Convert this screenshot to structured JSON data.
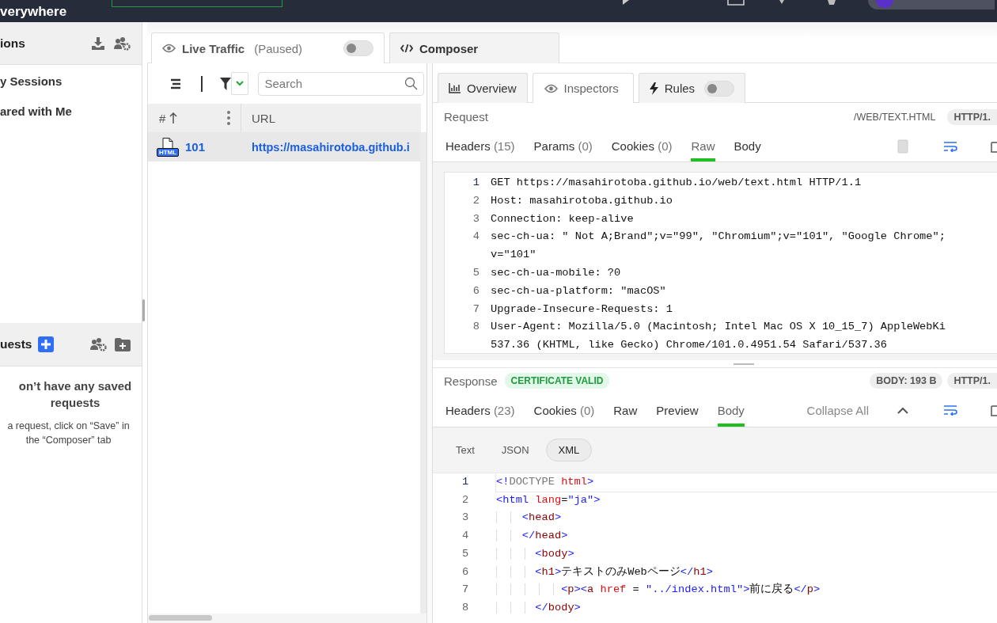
{
  "top_bar": {
    "title": "verywhere"
  },
  "sidebar": {
    "sessions": {
      "title": "ions",
      "items": [
        "y Sessions",
        "ared with Me"
      ]
    },
    "saved_requests": {
      "title": "uests",
      "empty_title": "on’t have any saved requests",
      "empty_hint": "a request, click on “Save” in the “Composer” tab"
    }
  },
  "main_tabs": [
    {
      "kind": "live",
      "label": "Live Traffic",
      "note": "(Paused)",
      "toggle": false,
      "selected": true
    },
    {
      "kind": "composer",
      "label": "Composer",
      "selected": false
    }
  ],
  "traffic": {
    "search": {
      "placeholder": "Search"
    },
    "columns": [
      "#",
      "URL"
    ],
    "rows": [
      {
        "badge": "HTML",
        "number": "101",
        "url": "https://masahirotoba.github.i",
        "selected": true
      }
    ]
  },
  "inspector": {
    "tabs": [
      {
        "kind": "overview",
        "label": "Overview",
        "selected": false
      },
      {
        "kind": "inspectors",
        "label": "Inspectors",
        "selected": true
      },
      {
        "kind": "rules",
        "label": "Rules",
        "toggle": false,
        "selected": false
      }
    ],
    "request": {
      "title": "Request",
      "path": "/WEB/TEXT.HTML",
      "protocol": "HTTP/1.",
      "tabs": [
        {
          "label": "Headers",
          "count": "(15)",
          "selected": false
        },
        {
          "label": "Params",
          "count": "(0)",
          "selected": false
        },
        {
          "label": "Cookies",
          "count": "(0)",
          "selected": false
        },
        {
          "label": "Raw",
          "selected": true
        },
        {
          "label": "Body",
          "selected": false
        }
      ],
      "lines": [
        {
          "number": "1",
          "active": true,
          "text": [
            "GET https://masahirotoba.github.io/web/text.html HTTP/1.1"
          ]
        },
        {
          "number": "2",
          "active": false,
          "text": [
            "Host: masahirotoba.github.io"
          ]
        },
        {
          "number": "3",
          "active": false,
          "text": [
            "Connection: keep-alive"
          ]
        },
        {
          "number": "4",
          "active": false,
          "text": [
            "sec-ch-ua: \" Not A;Brand\";v=\"99\", \"Chromium\";v=\"101\", \"Google Chrome\";",
            "v=\"101\""
          ]
        },
        {
          "number": "5",
          "active": false,
          "text": [
            "sec-ch-ua-mobile: ?0"
          ]
        },
        {
          "number": "6",
          "active": false,
          "text": [
            "sec-ch-ua-platform: \"macOS\""
          ]
        },
        {
          "number": "7",
          "active": false,
          "text": [
            "Upgrade-Insecure-Requests: 1"
          ]
        },
        {
          "number": "8",
          "active": false,
          "text": [
            "User-Agent: Mozilla/5.0 (Macintosh; Intel Mac OS X 10_15_7) AppleWebKi",
            "537.36 (KHTML, like Gecko) Chrome/101.0.4951.54 Safari/537.36"
          ]
        }
      ]
    },
    "response": {
      "title": "Response",
      "badge": "CERTIFICATE VALID",
      "size": "BODY: 193 B",
      "protocol": "HTTP/1.",
      "tabs": [
        {
          "label": "Headers",
          "count": "(23)",
          "selected": false
        },
        {
          "label": "Cookies",
          "count": "(0)",
          "selected": false
        },
        {
          "label": "Raw",
          "selected": false
        },
        {
          "label": "Preview",
          "selected": false
        },
        {
          "label": "Body",
          "selected": true
        }
      ],
      "collapse": "Collapse All",
      "formats": [
        {
          "label": "Text",
          "selected": false
        },
        {
          "label": "JSON",
          "selected": false
        },
        {
          "label": "XML",
          "selected": true
        }
      ],
      "lines": [
        {
          "number": "1",
          "active": true,
          "tokens": [
            {
              "kind": "punct",
              "text": "<!"
            },
            {
              "kind": "doctype",
              "text": "DOCTYPE "
            },
            {
              "kind": "attr",
              "text": "html"
            },
            {
              "kind": "punct",
              "text": ">"
            }
          ]
        },
        {
          "number": "2",
          "active": false,
          "tokens": [
            {
              "kind": "punct",
              "text": "<html "
            },
            {
              "kind": "attr",
              "text": "lang"
            },
            {
              "kind": "text",
              "text": "="
            },
            {
              "kind": "str",
              "text": "\"ja\""
            },
            {
              "kind": "punct",
              "text": ">"
            }
          ]
        },
        {
          "number": "3",
          "active": false,
          "tokens": [
            {
              "kind": "punct",
              "text": "    <"
            },
            {
              "kind": "tag",
              "text": "head"
            },
            {
              "kind": "punct",
              "text": ">"
            }
          ]
        },
        {
          "number": "4",
          "active": false,
          "tokens": [
            {
              "kind": "punct",
              "text": "    </"
            },
            {
              "kind": "tag",
              "text": "head"
            },
            {
              "kind": "punct",
              "text": ">"
            }
          ]
        },
        {
          "number": "5",
          "active": false,
          "tokens": [
            {
              "kind": "punct",
              "text": "      <"
            },
            {
              "kind": "tag",
              "text": "body"
            },
            {
              "kind": "punct",
              "text": ">"
            }
          ]
        },
        {
          "number": "6",
          "active": false,
          "tokens": [
            {
              "kind": "punct",
              "text": "      <"
            },
            {
              "kind": "tag",
              "text": "h1"
            },
            {
              "kind": "punct",
              "text": ">"
            },
            {
              "kind": "text",
              "text": "テキストのみWebページ"
            },
            {
              "kind": "punct",
              "text": "</"
            },
            {
              "kind": "tag",
              "text": "h1"
            },
            {
              "kind": "punct",
              "text": ">"
            }
          ]
        },
        {
          "number": "7",
          "active": false,
          "tokens": [
            {
              "kind": "punct",
              "text": "          <"
            },
            {
              "kind": "tag",
              "text": "p"
            },
            {
              "kind": "punct",
              "text": "><"
            },
            {
              "kind": "tag",
              "text": "a "
            },
            {
              "kind": "attr",
              "text": "href"
            },
            {
              "kind": "text",
              "text": " = "
            },
            {
              "kind": "str",
              "text": "\"../index.html\""
            },
            {
              "kind": "punct",
              "text": ">"
            },
            {
              "kind": "text",
              "text": "前に戻る"
            },
            {
              "kind": "punct",
              "text": "</"
            },
            {
              "kind": "tag",
              "text": "p"
            },
            {
              "kind": "punct",
              "text": ">"
            }
          ]
        },
        {
          "number": "8",
          "active": false,
          "tokens": [
            {
              "kind": "punct",
              "text": "      </"
            },
            {
              "kind": "tag",
              "text": "body"
            },
            {
              "kind": "punct",
              "text": ">"
            }
          ]
        }
      ]
    }
  }
}
